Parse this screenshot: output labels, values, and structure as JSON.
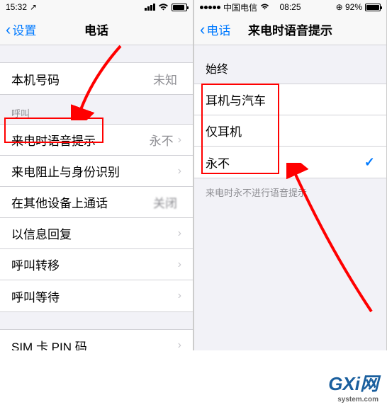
{
  "left": {
    "status": {
      "time": "15:32",
      "loc_indicator": "↗"
    },
    "nav": {
      "back": "设置",
      "title": "电话"
    },
    "items": {
      "my_number": {
        "label": "本机号码",
        "value": "未知"
      },
      "section_calls": "呼叫",
      "announce": {
        "label": "来电时语音提示",
        "value": "永不"
      },
      "block": {
        "label": "来电阻止与身份识别"
      },
      "other_devices": {
        "label": "在其他设备上通话",
        "value": "关闭"
      },
      "respond": {
        "label": "以信息回复"
      },
      "forwarding": {
        "label": "呼叫转移"
      },
      "waiting": {
        "label": "呼叫等待"
      },
      "sim_pin": {
        "label": "SIM 卡 PIN 码"
      }
    }
  },
  "right": {
    "status": {
      "carrier": "中国电信",
      "time": "08:25",
      "battery": "92%"
    },
    "nav": {
      "back": "电话",
      "title": "来电时语音提示"
    },
    "section": "始终",
    "options": {
      "headphones_car": "耳机与汽车",
      "headphones_only": "仅耳机",
      "never": "永不"
    },
    "footer": "来电时永不进行语音提示"
  },
  "watermark": {
    "main": "GXi网",
    "sub": "system.com"
  }
}
